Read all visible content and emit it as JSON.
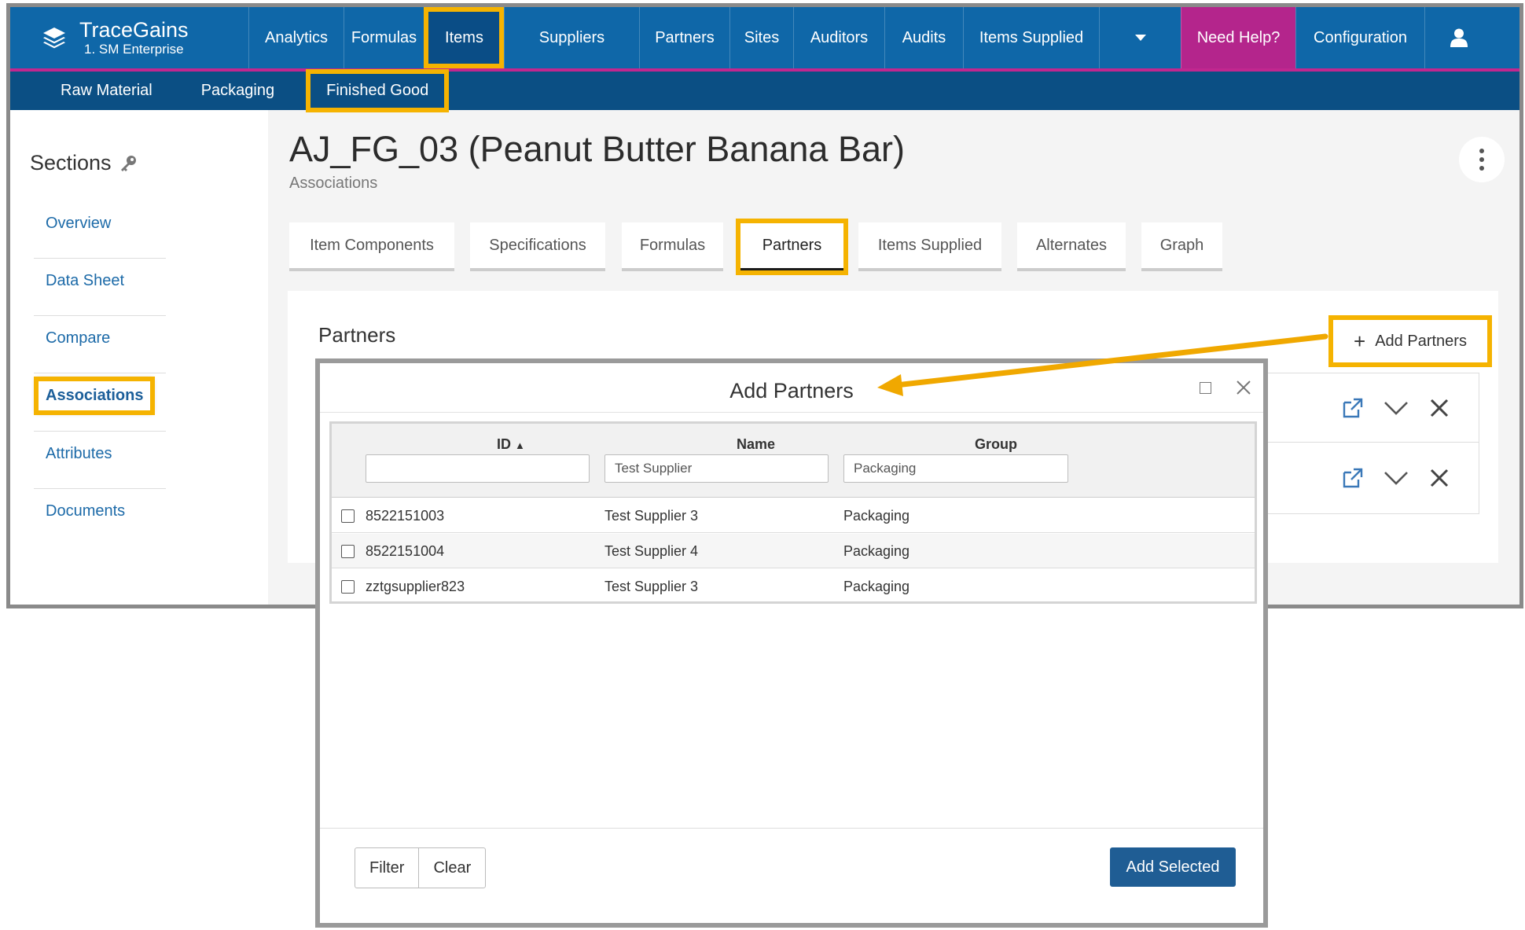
{
  "app": {
    "brand_name": "TraceGains",
    "brand_sub": "1. SM Enterprise"
  },
  "topnav": {
    "items": [
      "Analytics",
      "Formulas",
      "Items",
      "Suppliers",
      "Partners",
      "Sites",
      "Auditors",
      "Audits",
      "Items Supplied"
    ],
    "help": "Need Help?",
    "configuration": "Configuration"
  },
  "subnav": {
    "items": [
      "Raw Material",
      "Packaging",
      "Finished Good"
    ]
  },
  "sidebar": {
    "title": "Sections",
    "items": [
      "Overview",
      "Data Sheet",
      "Compare",
      "Associations",
      "Attributes",
      "Documents"
    ]
  },
  "page": {
    "title": "AJ_FG_03 (Peanut Butter Banana Bar)",
    "subtitle": "Associations"
  },
  "tabs": [
    "Item Components",
    "Specifications",
    "Formulas",
    "Partners",
    "Items Supplied",
    "Alternates",
    "Graph"
  ],
  "partners_card": {
    "title": "Partners",
    "add_button": "Add Partners",
    "plus": "+"
  },
  "modal": {
    "title": "Add Partners",
    "columns": {
      "id": "ID",
      "id_sort": "▲",
      "name": "Name",
      "group": "Group"
    },
    "filters": {
      "id": "",
      "name": "Test Supplier",
      "group": "Packaging"
    },
    "rows": [
      {
        "id": "8522151003",
        "name": "Test Supplier 3",
        "group": "Packaging"
      },
      {
        "id": "8522151004",
        "name": "Test Supplier 4",
        "group": "Packaging"
      },
      {
        "id": "zztgsupplier823",
        "name": "Test Supplier 3",
        "group": "Packaging"
      }
    ],
    "filter_button": "Filter",
    "clear_button": "Clear",
    "add_selected_button": "Add Selected"
  },
  "colors": {
    "topnav": "#0f67a8",
    "subnav": "#0b4f84",
    "help": "#b4258c",
    "highlight": "#f5b301",
    "primary_button": "#1f5d94"
  }
}
